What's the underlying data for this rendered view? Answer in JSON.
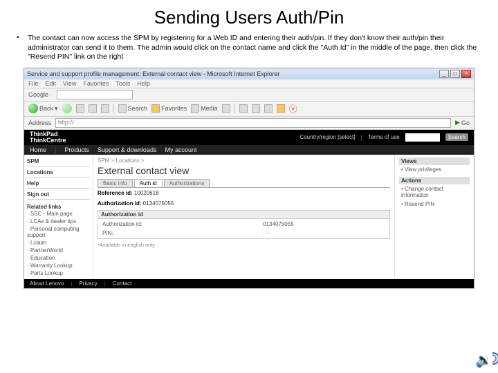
{
  "slide": {
    "title": "Sending Users Auth/Pin",
    "bullet": "The contact can now access the SPM by registering for a Web ID and entering their auth/pin.  If they don't know their auth/pin their administrator can send it to them.  The admin would click on the contact name and click the \"Auth Id\" in the middle of the page, then click the \"Resend PIN\" link on the right"
  },
  "ie": {
    "title": "Service and support profile management: External contact view - Microsoft Internet Explorer",
    "menu": [
      "File",
      "Edit",
      "View",
      "Favorites",
      "Tools",
      "Help"
    ],
    "google": "Google ·",
    "back": "Back",
    "search": "Search",
    "favorites": "Favorites",
    "media": "Media",
    "address_label": "Address",
    "address_value": "http://",
    "go": "Go"
  },
  "lenovo": {
    "logo1": "ThinkPad",
    "logo1b": ".",
    "logo2": "ThinkCentre",
    "logo2b": ".",
    "region": "Country/region [select]",
    "terms": "Terms of use",
    "search": "Search",
    "nav": [
      "Home",
      "Products",
      "Support & downloads",
      "My account"
    ]
  },
  "left": {
    "items": [
      "SPM",
      "Locations",
      "Help",
      "Sign out"
    ],
    "related_label": "Related links",
    "related": [
      "SSC - Main page",
      "LCAs & dealer tips",
      "Personal computing support",
      "I.claim",
      "PartnerWorld",
      "Education",
      "Warranty Lookup",
      "Parts Lookup"
    ]
  },
  "main": {
    "crumb": "SPM > Locations >",
    "title": "External contact view",
    "tabs": [
      "Basic info",
      "Auth id",
      "Authorizations"
    ],
    "ref_label": "Reference id:",
    "ref_val": "10020618",
    "auth_label": "Authorization id:",
    "auth_val": "0134075055",
    "box_title": "Authorization id",
    "rows": [
      {
        "k": "Authorization id:",
        "v": "0134075055"
      },
      {
        "k": "PIN:",
        "v": "····"
      }
    ],
    "engnote": "*Available in english only"
  },
  "right": {
    "views": {
      "hd": "Views",
      "item": "View privileges"
    },
    "actions": {
      "hd": "Actions",
      "item1": "Change contact information",
      "item2": "Resend PIN"
    }
  },
  "footer": [
    "About Lenovo",
    "Privacy",
    "Contact"
  ]
}
